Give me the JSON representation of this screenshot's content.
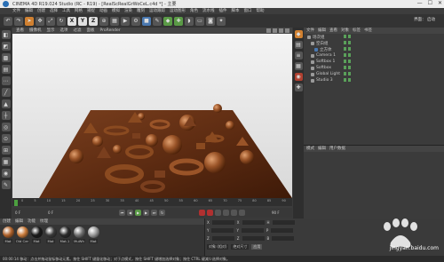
{
  "window": {
    "title": "CINEMA 4D R19.024 Studio (RC - R19) - [RealScRealGrWoCeL.c4d *] - 主要",
    "controls": [
      "—",
      "☐",
      "✕"
    ]
  },
  "menubar": {
    "items": [
      "文件",
      "编辑",
      "创建",
      "选择",
      "工具",
      "网格",
      "捕捉",
      "动画",
      "模拟",
      "渲染",
      "雕刻",
      "运动跟踪",
      "运动图形",
      "角色",
      "流水线",
      "插件",
      "脚本",
      "窗口",
      "帮助"
    ],
    "layout_label": "界面： 启动"
  },
  "toolbar": {
    "buttons": [
      "undo",
      "redo",
      "select",
      "move",
      "scale",
      "rotate",
      "X",
      "Y",
      "Z",
      "coord",
      "render-region",
      "render",
      "render-settings",
      "cube",
      "pen",
      "subdivide",
      "array",
      "deform",
      "floor",
      "camera",
      "light"
    ]
  },
  "viewport": {
    "menu": [
      "查看",
      "摄像机",
      "显示",
      "选项",
      "过滤",
      "面板",
      "ProRender"
    ]
  },
  "timeline": {
    "ticks": [
      "0",
      "5",
      "10",
      "15",
      "20",
      "25",
      "30",
      "35",
      "40",
      "45",
      "50",
      "55",
      "60",
      "65",
      "70",
      "75",
      "80",
      "85",
      "90"
    ],
    "frame_start": "0 F",
    "frame_end": "90 F",
    "current": "0 F"
  },
  "object_manager": {
    "menu": [
      "文件",
      "编辑",
      "查看",
      "对象",
      "标签",
      "书签"
    ],
    "objects": [
      {
        "name": "场次组",
        "indent": 0
      },
      {
        "name": "空白组",
        "indent": 1
      },
      {
        "name": "立方体",
        "indent": 2
      },
      {
        "name": "Camera 1",
        "indent": 1
      },
      {
        "name": "Softbox 1",
        "indent": 1
      },
      {
        "name": "Softbox",
        "indent": 1
      },
      {
        "name": "Global Light",
        "indent": 1
      },
      {
        "name": "Studio 3",
        "indent": 1
      }
    ]
  },
  "attribute_manager": {
    "tabs": [
      "模式",
      "编辑",
      "用户数据"
    ]
  },
  "material_manager": {
    "menu": [
      "创建",
      "编辑",
      "功能",
      "纹理"
    ],
    "materials": [
      {
        "label": "Mat",
        "color": "#b0622a"
      },
      {
        "label": "Old Cer",
        "color": "#c87a3a"
      },
      {
        "label": "Mat",
        "color": "#1a1a1a"
      },
      {
        "label": "Mat",
        "color": "#3a3a3a"
      },
      {
        "label": "Mat.1",
        "color": "#2a2a2a"
      },
      {
        "label": "MuWh",
        "color": "#707070"
      },
      {
        "label": "Mat",
        "color": "#9a9a9a"
      }
    ]
  },
  "coordinates": {
    "rows": [
      {
        "a": "X",
        "b": "X",
        "c": "H"
      },
      {
        "a": "Y",
        "b": "Y",
        "c": "P"
      },
      {
        "a": "Z",
        "b": "Z",
        "c": "B"
      }
    ],
    "mode": "对象 (相对)",
    "size_mode": "绝对尺寸",
    "apply": "应用"
  },
  "statusbar": {
    "text": "00:00:14  移动：点击并拖动鼠标移动元素。按住 SHIFT 键量化移动；对于点模式，按住 SHIFT 键增加选择对象；按住 CTRL 键减少选择对象。"
  },
  "watermark": {
    "text": "jingyan.baidu.com"
  }
}
